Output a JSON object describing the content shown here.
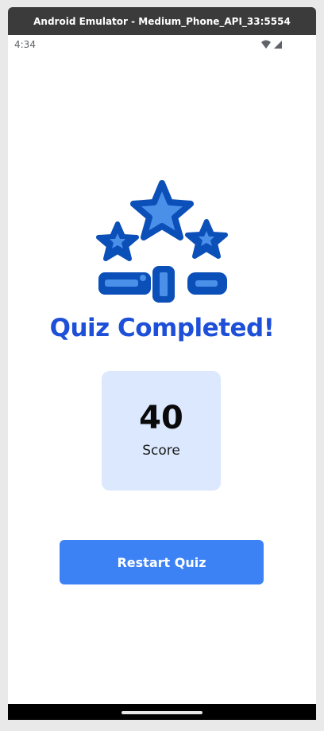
{
  "window": {
    "title": "Android Emulator - Medium_Phone_API_33:5554"
  },
  "status_bar": {
    "time": "4:34",
    "icons": [
      "wifi-icon",
      "cellular-signal-icon"
    ]
  },
  "quiz_result": {
    "heading": "Quiz Completed!",
    "score_value": "40",
    "score_label": "Score",
    "restart_label": "Restart Quiz"
  },
  "colors": {
    "accent": "#3d82f5",
    "heading": "#1e4fd8",
    "card_background": "#dbe8fd",
    "icon_dark": "#0b4fb8",
    "icon_light": "#4a8fe8"
  }
}
